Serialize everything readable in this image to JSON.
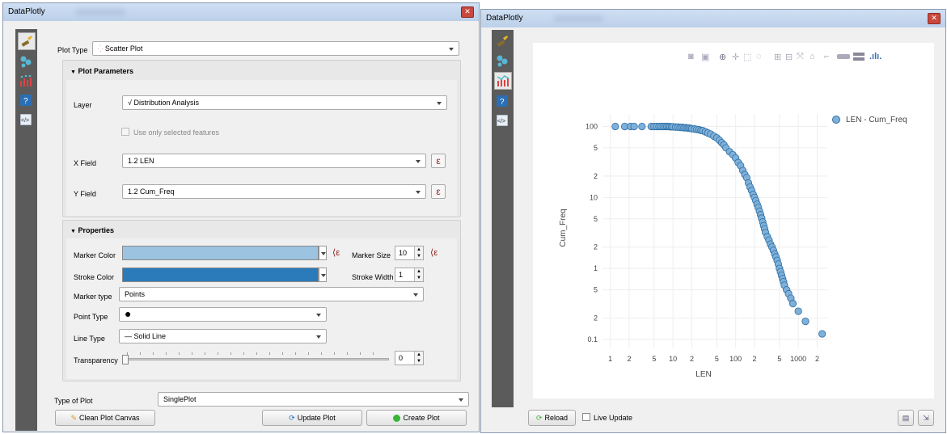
{
  "left": {
    "window_title": "DataPlotly",
    "plot_type_label": "Plot Type",
    "plot_type_value": "Scatter Plot",
    "plot_params_header": "Plot Parameters",
    "layer_label": "Layer",
    "layer_value": "Distribution Analysis",
    "use_selected_label": "Use only selected features",
    "x_field_label": "X Field",
    "x_field_value": "1.2 LEN",
    "y_field_label": "Y Field",
    "y_field_value": "1.2 Cum_Freq",
    "properties_header": "Properties",
    "marker_color_label": "Marker Color",
    "marker_color": "#9cc3e0",
    "marker_size_label": "Marker Size",
    "marker_size_value": "10",
    "stroke_color_label": "Stroke Color",
    "stroke_color": "#2b7bba",
    "stroke_width_label": "Stroke Width",
    "stroke_width_value": "1",
    "marker_type_label": "Marker type",
    "marker_type_value": "Points",
    "point_type_label": "Point Type",
    "point_type_value": "●",
    "line_type_label": "Line Type",
    "line_type_value": "— Solid Line",
    "transparency_label": "Transparency",
    "transparency_value": "0",
    "type_of_plot_label": "Type of Plot",
    "type_of_plot_value": "SinglePlot",
    "clean_button": "Clean Plot Canvas",
    "update_button": "Update Plot",
    "create_button": "Create Plot",
    "sidebar_icons": [
      "brush-icon",
      "settings-icon",
      "plot-icon",
      "help-icon",
      "code-icon"
    ]
  },
  "right": {
    "window_title": "DataPlotly",
    "reload_button": "Reload",
    "live_update_label": "Live Update",
    "sidebar_icons": [
      "brush-icon",
      "settings-icon",
      "plot-icon",
      "help-icon",
      "code-icon"
    ],
    "modebar_icons": [
      "camera-icon",
      "save-icon",
      "zoom-icon",
      "pan-icon",
      "box-select-icon",
      "lasso-icon",
      "zoom-in-icon",
      "zoom-out-icon",
      "autoscale-icon",
      "home-icon",
      "spike-icon",
      "hover-closest-icon",
      "hover-compare-icon",
      "plotly-logo-icon"
    ]
  },
  "chart_data": {
    "type": "scatter",
    "xlabel": "LEN",
    "ylabel": "Cum_Freq",
    "x_scale": "log",
    "y_scale": "log",
    "xlim": [
      0.75,
      2900
    ],
    "ylim": [
      0.075,
      150
    ],
    "x_ticks": [
      "1",
      "2",
      "5",
      "10",
      "2",
      "5",
      "100",
      "2",
      "5",
      "1000",
      "2"
    ],
    "y_ticks": [
      "100",
      "5",
      "2",
      "10",
      "5",
      "2",
      "1",
      "5",
      "2",
      "0.1"
    ],
    "legend_position": "top-right",
    "marker_color": "#7fb0d8",
    "stroke_color": "#2b6ea6",
    "series": [
      {
        "name": "LEN - Cum_Freq",
        "x": [
          1.2,
          1.7,
          2.1,
          2.4,
          3.2,
          4.5,
          5.0,
          5.5,
          6.0,
          6.5,
          7.0,
          7.5,
          8.0,
          8.5,
          9.0,
          9.5,
          10,
          11,
          12,
          13,
          14,
          15,
          16,
          17,
          18,
          19,
          20,
          22,
          24,
          26,
          28,
          30,
          33,
          36,
          40,
          45,
          50,
          55,
          60,
          65,
          70,
          80,
          90,
          100,
          110,
          120,
          130,
          140,
          150,
          160,
          170,
          180,
          190,
          200,
          210,
          220,
          230,
          240,
          250,
          260,
          270,
          280,
          290,
          300,
          320,
          340,
          360,
          380,
          400,
          420,
          440,
          460,
          480,
          500,
          520,
          540,
          560,
          580,
          600,
          650,
          700,
          760,
          820,
          1000,
          1300,
          2400
        ],
        "y": [
          100,
          100,
          100,
          100,
          100,
          100,
          100,
          100,
          100,
          100,
          100,
          100,
          100,
          100,
          99,
          99,
          99,
          98,
          98,
          97,
          97,
          96,
          96,
          95,
          95,
          94,
          93,
          92,
          91,
          90,
          88,
          87,
          84,
          81,
          78,
          73,
          69,
          64,
          59,
          55,
          50,
          44,
          40,
          36,
          31,
          28,
          24,
          21,
          19,
          16,
          14,
          12.5,
          11,
          10,
          9,
          8,
          7.2,
          6.4,
          5.7,
          5.1,
          4.5,
          4.0,
          3.6,
          3.2,
          2.8,
          2.5,
          2.2,
          2.0,
          1.8,
          1.6,
          1.45,
          1.3,
          1.15,
          1.0,
          0.9,
          0.8,
          0.72,
          0.65,
          0.58,
          0.5,
          0.44,
          0.38,
          0.32,
          0.25,
          0.18,
          0.12
        ]
      }
    ]
  }
}
